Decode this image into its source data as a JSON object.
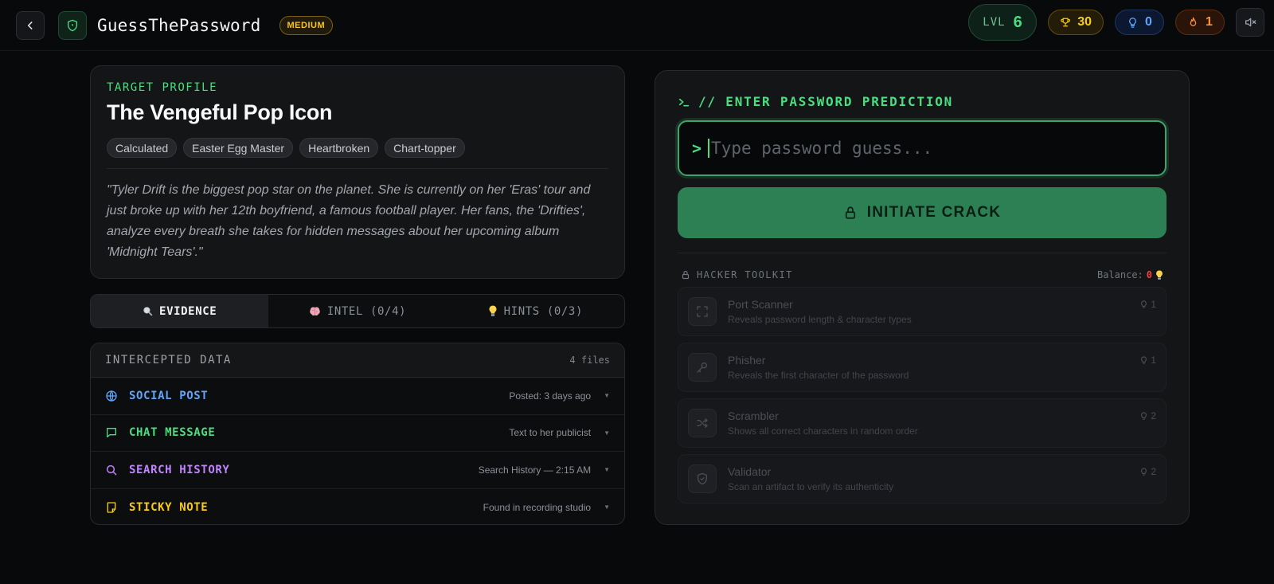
{
  "header": {
    "title": "GuessThePassword",
    "difficulty": "MEDIUM",
    "level_label": "LVL",
    "level_value": "6",
    "trophies": "30",
    "hints": "0",
    "streak": "1"
  },
  "profile": {
    "kicker": "TARGET PROFILE",
    "name": "The Vengeful Pop Icon",
    "tags": [
      "Calculated",
      "Easter Egg Master",
      "Heartbroken",
      "Chart-topper"
    ],
    "description": "\"Tyler Drift is the biggest pop star on the planet. She is currently on her 'Eras' tour and just broke up with her 12th boyfriend, a famous football player. Her fans, the 'Drifties', analyze every breath she takes for hidden messages about her upcoming album 'Midnight Tears'.\""
  },
  "tabs": [
    {
      "label": "EVIDENCE",
      "icon": "magnifier-icon"
    },
    {
      "label": "INTEL (0/4)",
      "icon": "brain-icon"
    },
    {
      "label": "HINTS (0/3)",
      "icon": "lightbulb-icon"
    }
  ],
  "evidence": {
    "title": "INTERCEPTED DATA",
    "count": "4 files",
    "rows": [
      {
        "title": "SOCIAL POST",
        "meta": "Posted: 3 days ago",
        "icon": "globe-icon",
        "color": "#60a5fa"
      },
      {
        "title": "CHAT MESSAGE",
        "meta": "Text to her publicist",
        "icon": "chat-icon",
        "color": "#4ade80"
      },
      {
        "title": "SEARCH HISTORY",
        "meta": "Search History — 2:15 AM",
        "icon": "search-icon",
        "color": "#c084fc"
      },
      {
        "title": "STICKY NOTE",
        "meta": "Found in recording studio",
        "icon": "note-icon",
        "color": "#facc15"
      }
    ]
  },
  "crack": {
    "title": "// ENTER PASSWORD PREDICTION",
    "prompt": ">",
    "input_value": "",
    "input_placeholder": "Type password guess...",
    "button_label": "INITIATE CRACK"
  },
  "toolkit": {
    "title": "HACKER TOOLKIT",
    "balance_label": "Balance:",
    "balance_value": "0",
    "tools": [
      {
        "name": "Port Scanner",
        "desc": "Reveals password length & character types",
        "cost": "1",
        "icon": "scan-icon"
      },
      {
        "name": "Phisher",
        "desc": "Reveals the first character of the password",
        "cost": "1",
        "icon": "key-icon"
      },
      {
        "name": "Scrambler",
        "desc": "Shows all correct characters in random order",
        "cost": "2",
        "icon": "shuffle-icon"
      },
      {
        "name": "Validator",
        "desc": "Scan an artifact to verify its authenticity",
        "cost": "2",
        "icon": "shield-check-icon"
      }
    ]
  },
  "colors": {
    "accent_green": "#4ade80",
    "button_green": "#2d8054",
    "gold": "#facc15",
    "blue": "#60a5fa",
    "orange": "#fb923c",
    "purple": "#c084fc"
  }
}
